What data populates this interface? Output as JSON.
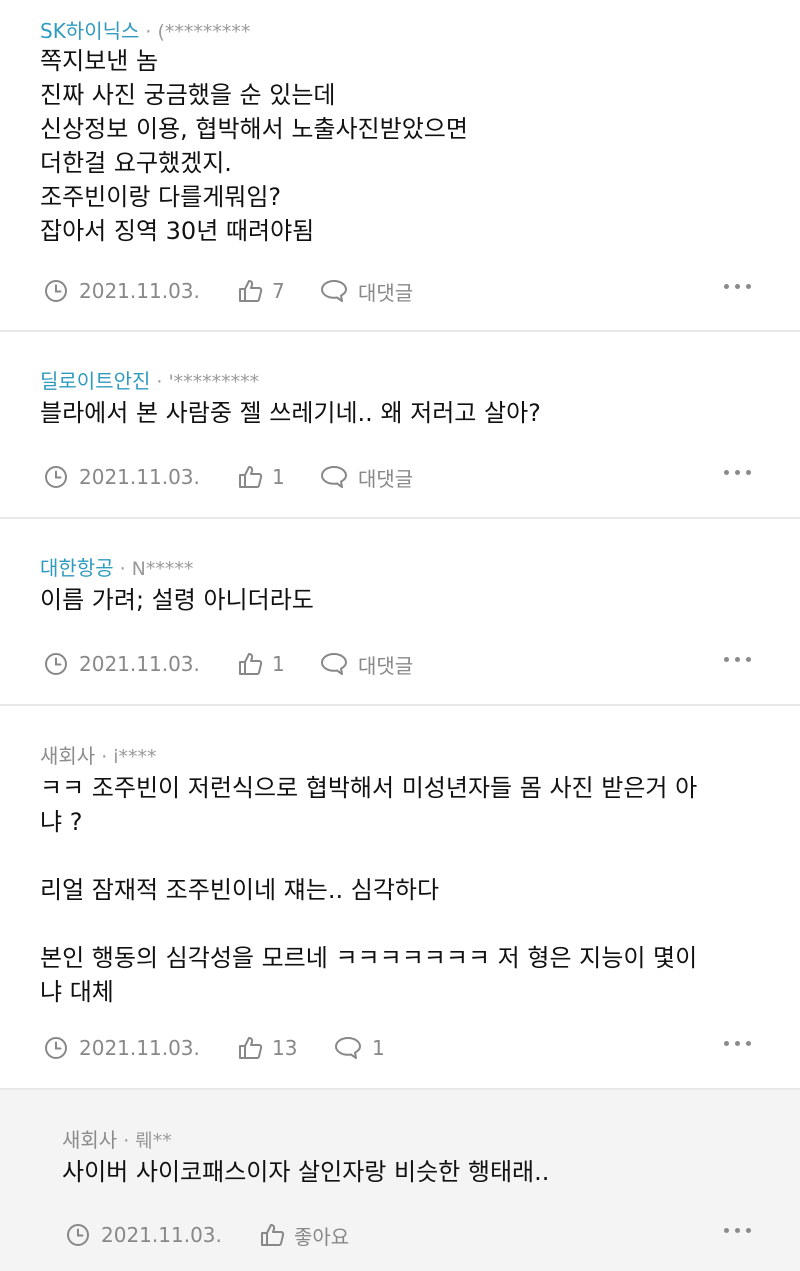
{
  "comments": [
    {
      "company": "SK하이닉스",
      "author": "(*********",
      "lines": [
        "쪽지보낸 놈",
        "진짜 사진 궁금했을 순 있는데",
        "신상정보 이용, 협박해서 노출사진받았으면",
        "더한걸 요구했겠지.",
        "조주빈이랑 다를게뭐임?",
        "잡아서 징역 30년 때려야됨"
      ],
      "date": "2021.11.03.",
      "likes": "7",
      "reply_label": "대댓글"
    },
    {
      "company": "딜로이트안진",
      "author": "'*********",
      "lines": [
        "블라에서 본 사람중 젤 쓰레기네.. 왜 저러고 살아?"
      ],
      "date": "2021.11.03.",
      "likes": "1",
      "reply_label": "대댓글"
    },
    {
      "company": "대한항공",
      "author": "N*****",
      "lines": [
        "이름 가려; 설령 아니더라도"
      ],
      "date": "2021.11.03.",
      "likes": "1",
      "reply_label": "대댓글"
    },
    {
      "company": "새회사",
      "author": "i****",
      "lines": [
        "ㅋㅋ 조주빈이 저런식으로 협박해서 미성년자들 몸 사진 받은거 아",
        "냐 ?",
        "",
        "리얼 잠재적 조주빈이네 쟤는.. 심각하다",
        "",
        "본인 행동의 심각성을 모르네 ㅋㅋㅋㅋㅋㅋㅋ 저 형은 지능이 몇이",
        "냐 대체"
      ],
      "date": "2021.11.03.",
      "likes": "13",
      "reply_count": "1"
    },
    {
      "company": "새회사",
      "author": "뤠**",
      "lines": [
        "사이버 사이코패스이자 살인자랑 비슷한 행태래.."
      ],
      "date": "2021.11.03.",
      "like_label": "좋아요"
    }
  ]
}
